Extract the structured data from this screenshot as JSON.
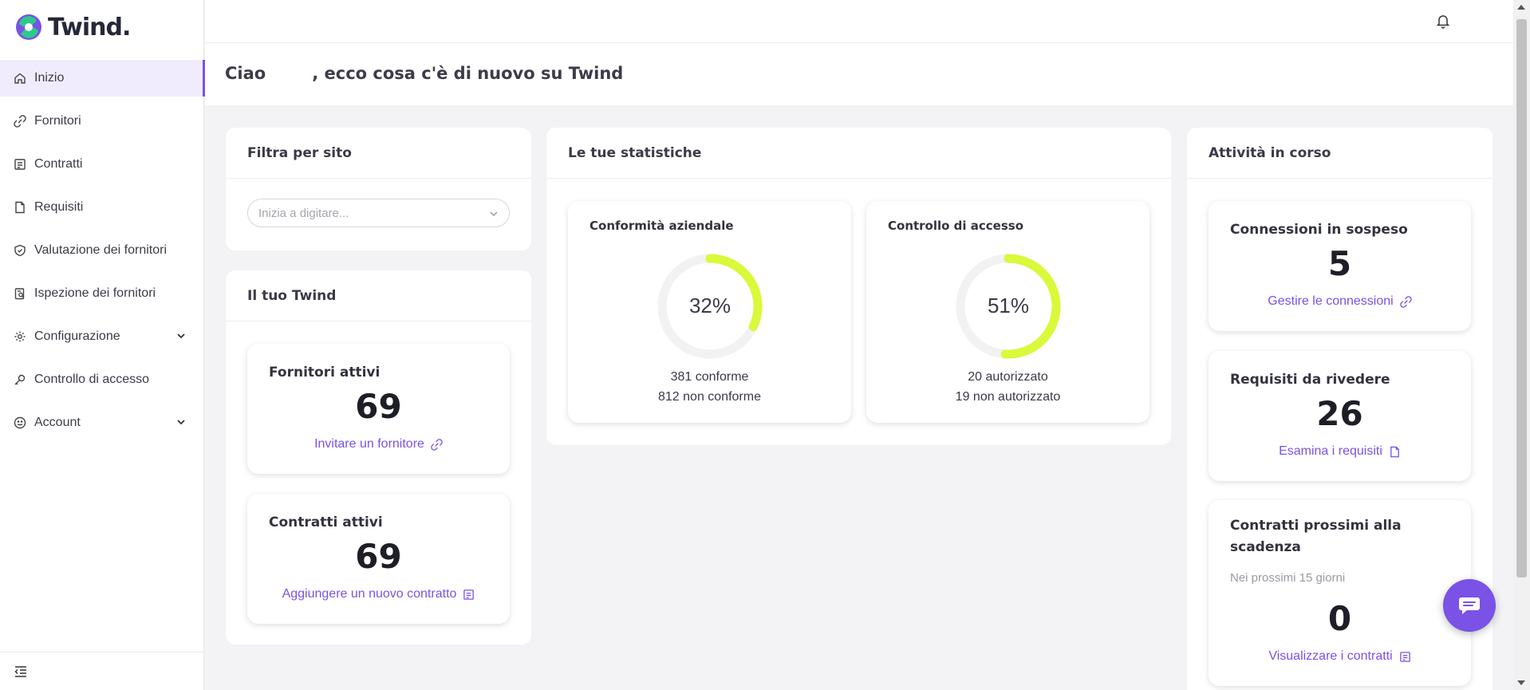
{
  "brand": {
    "name": "Twind."
  },
  "sidebar": {
    "items": [
      {
        "label": "Inizio",
        "icon": "home-icon",
        "active": true
      },
      {
        "label": "Fornitori",
        "icon": "link-icon"
      },
      {
        "label": "Contratti",
        "icon": "contract-icon"
      },
      {
        "label": "Requisiti",
        "icon": "document-icon"
      },
      {
        "label": "Valutazione dei fornitori",
        "icon": "shield-check-icon"
      },
      {
        "label": "Ispezione dei fornitori",
        "icon": "clipboard-search-icon"
      },
      {
        "label": "Configurazione",
        "icon": "gear-icon",
        "expandable": true
      },
      {
        "label": "Controllo di accesso",
        "icon": "key-icon"
      },
      {
        "label": "Account",
        "icon": "user-circle-icon",
        "expandable": true
      }
    ],
    "collapse_icon": "collapse-menu-icon"
  },
  "header": {
    "greeting_prefix": "Ciao",
    "greeting_suffix": ", ecco cosa c'è di nuovo su Twind"
  },
  "filter": {
    "title": "Filtra per sito",
    "placeholder": "Inizia a digitare..."
  },
  "your_twind": {
    "title": "Il tuo Twind",
    "active_suppliers": {
      "title": "Fornitori attivi",
      "value": "69",
      "action": "Invitare un fornitore"
    },
    "active_contracts": {
      "title": "Contratti attivi",
      "value": "69",
      "action": "Aggiungere un nuovo contratto"
    }
  },
  "stats": {
    "title": "Le tue statistiche",
    "compliance": {
      "title": "Conformità aziendale",
      "percent": 32,
      "percent_label": "32%",
      "line1": "381 conforme",
      "line2": "812 non conforme"
    },
    "access": {
      "title": "Controllo di accesso",
      "percent": 51,
      "percent_label": "51%",
      "line1": "20 autorizzato",
      "line2": "19 non autorizzato"
    }
  },
  "activities": {
    "title": "Attività in corso",
    "pending_connections": {
      "title": "Connessioni in sospeso",
      "value": "5",
      "action": "Gestire le connessioni"
    },
    "requirements_review": {
      "title": "Requisiti da rivedere",
      "value": "26",
      "action": "Esamina i requisiti"
    },
    "expiring_contracts": {
      "title": "Contratti prossimi alla scadenza",
      "note": "Nei prossimi 15 giorni",
      "value": "0",
      "action": "Visualizzare i contratti"
    }
  },
  "colors": {
    "accent": "#7a52e6",
    "donut": "#d9f93a",
    "donut_track": "#f2f2f2"
  }
}
